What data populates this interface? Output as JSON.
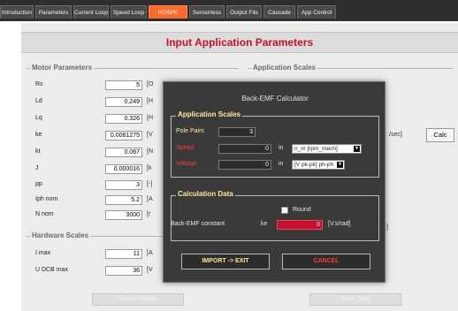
{
  "tabs": [
    {
      "label": "Introduction",
      "active": false
    },
    {
      "label": "Parameters",
      "active": false
    },
    {
      "label": "Current Loop",
      "active": false
    },
    {
      "label": "Speed Loop",
      "active": false
    },
    {
      "label": "POSPE Sensors",
      "active": true
    },
    {
      "label": "Sensorless",
      "active": false
    },
    {
      "label": "Output File",
      "active": false
    },
    {
      "label": "Cascade",
      "active": false
    },
    {
      "label": "App Control",
      "active": false
    }
  ],
  "page": {
    "title": "Input Application Parameters"
  },
  "motor_parameters": {
    "title": "Motor Parameters",
    "rows": [
      {
        "label": "Rs",
        "value": "5",
        "unit": "[O"
      },
      {
        "label": "Ld",
        "value": "0.249",
        "unit": "[H"
      },
      {
        "label": "Lq",
        "value": "0.326",
        "unit": "[H"
      },
      {
        "label": "ke",
        "value": "0.0061275",
        "unit": "[V"
      },
      {
        "label": "kt",
        "value": "0.067",
        "unit": "[N"
      },
      {
        "label": "J",
        "value": "0.000016",
        "unit": "[k"
      },
      {
        "label": "pp",
        "value": "3",
        "unit": "[-]"
      },
      {
        "label": "Iph nom",
        "value": "5.2",
        "unit": "[A"
      },
      {
        "label": "N nom",
        "value": "3000",
        "unit": "[r"
      }
    ]
  },
  "hardware_scales": {
    "title": "Hardware Scales",
    "rows": [
      {
        "label": "I max",
        "value": "11",
        "unit": "[A"
      },
      {
        "label": "U DCB max",
        "value": "36",
        "unit": "[V"
      }
    ]
  },
  "application_scales": {
    "title": "Application Scales",
    "unit_text": "/sec]",
    "calc_label": "Calc",
    "side_unit": "]"
  },
  "bottom_buttons": {
    "left": "Reset Default",
    "right": "Store Data"
  },
  "dialog": {
    "title": "Back-EMF Calculator",
    "app_scales": {
      "title": "Application Scales",
      "pole_pairs": {
        "label": "Pole Pairs",
        "value": "3"
      },
      "speed": {
        "label": "Speed",
        "value": "0",
        "in": "in",
        "unit": "n_m [rpm_mech]"
      },
      "voltage": {
        "label": "Voltage",
        "value": "0",
        "in": "in",
        "unit": "[V pk-pk] ph-ph"
      }
    },
    "calc_data": {
      "title": "Calculation Data",
      "round_label": "Round",
      "round_checked": false,
      "backemf_label": "Back-EMF constant",
      "ke_label": "ke",
      "ke_value": "0",
      "ke_unit": "[V.s/rad]"
    },
    "import_button": "IMPORT -> EXIT",
    "cancel_button": "CANCEL"
  },
  "colors": {
    "active_tab": "#ff6a2a",
    "title_red": "#c8102e",
    "dialog_bg": "#3a3a3a",
    "dialog_group_title": "#ffe99a",
    "speed_voltage_label": "#ff3b30",
    "ke_field": "#c8102e"
  }
}
